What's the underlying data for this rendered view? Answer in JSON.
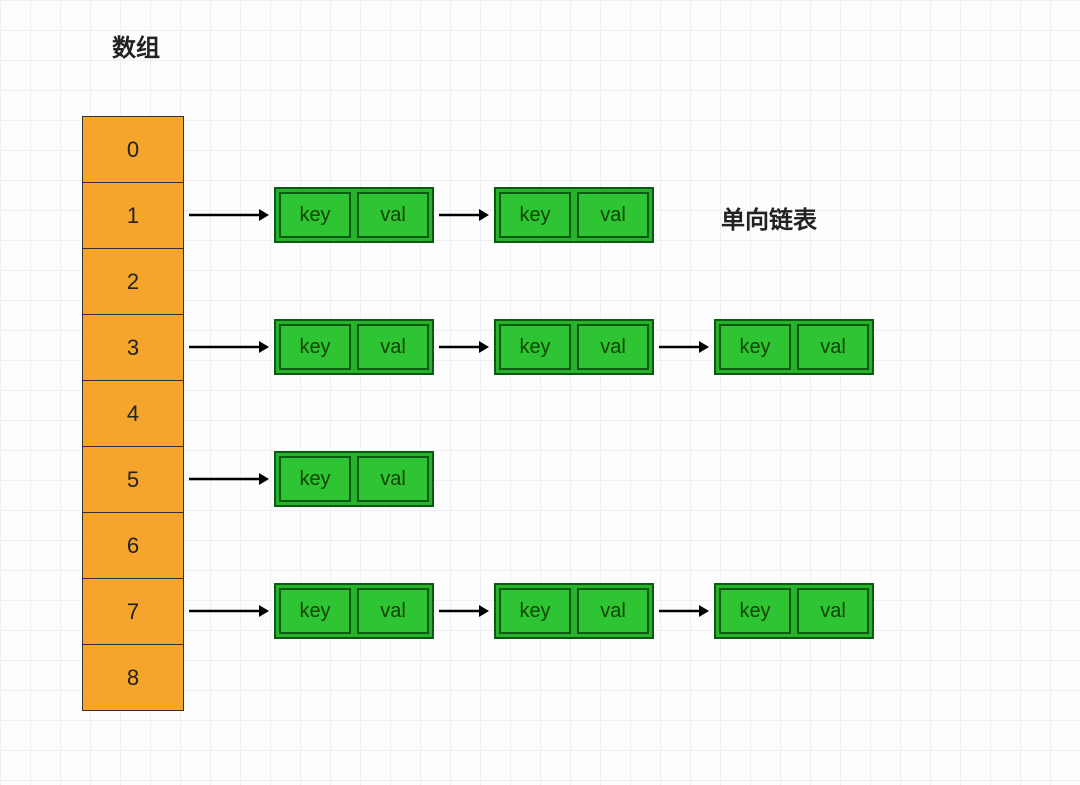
{
  "labels": {
    "array": "数组",
    "linkedList": "单向链表"
  },
  "array": {
    "indices": [
      "0",
      "1",
      "2",
      "3",
      "4",
      "5",
      "6",
      "7",
      "8"
    ]
  },
  "node": {
    "key": "key",
    "val": "val"
  },
  "rows": {
    "r1": {
      "index": 1,
      "count": 2
    },
    "r3": {
      "index": 3,
      "count": 3
    },
    "r5": {
      "index": 5,
      "count": 1
    },
    "r7": {
      "index": 7,
      "count": 3
    }
  },
  "colors": {
    "arrayFill": "#f5a52c",
    "nodeFill": "#2fc433",
    "nodeBorder": "#0b5a12"
  }
}
